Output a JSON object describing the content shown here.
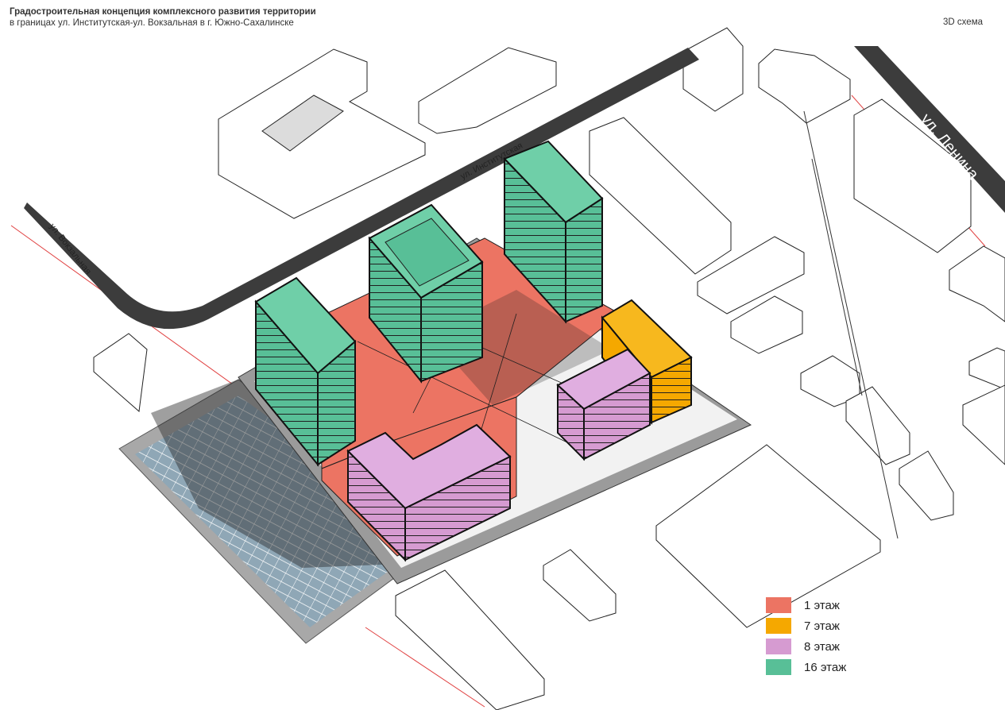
{
  "header": {
    "title": "Градостроительная концепция комплексного развития территории",
    "subtitle": "в границах ул. Институтская-ул. Вокзальная в г. Южно-Сахалинске",
    "scheme_label": "3D схема"
  },
  "streets": {
    "institutskaya": "ул. Институтская",
    "vokzalnaya": "ул. Вокзальная",
    "lenina": "ул. Ленина"
  },
  "legend": [
    {
      "label": "1 этаж",
      "color": "#ec7463"
    },
    {
      "label": "7 этаж",
      "color": "#f5a800"
    },
    {
      "label": "8 этаж",
      "color": "#d69bd1"
    },
    {
      "label": "16 этаж",
      "color": "#58bf97"
    }
  ],
  "colors": {
    "podium": "#ec7463",
    "seven_floor": "#f5a800",
    "eight_floor": "#d69bd1",
    "sixteen_floor": "#58bf97",
    "road": "#3c3c3c",
    "parking": "#8fa7b6",
    "pavement": "#a8a8a8",
    "boundary_red": "#e04040"
  }
}
